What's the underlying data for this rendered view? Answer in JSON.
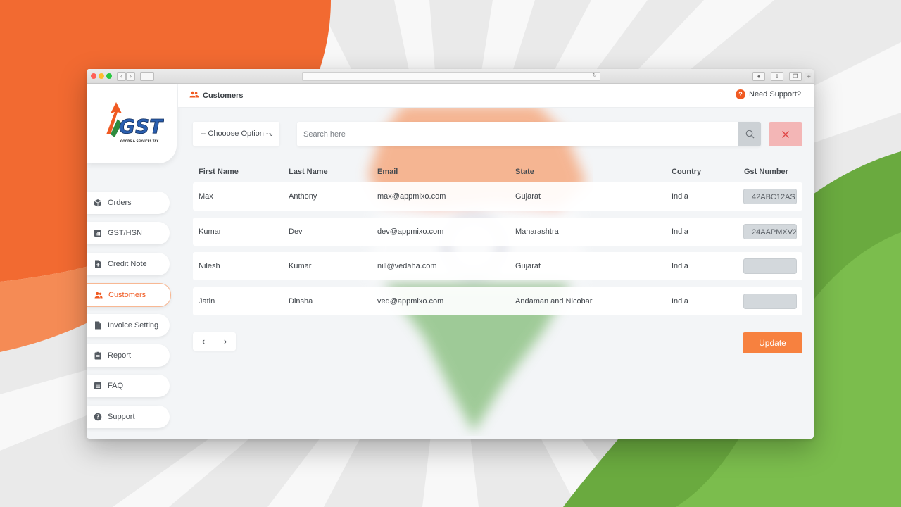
{
  "header": {
    "title": "Customers",
    "support_label": "Need Support?"
  },
  "logo": {
    "text": "GST",
    "tagline": "GOODS & SERVICES TAX"
  },
  "sidebar": {
    "items": [
      {
        "label": "Orders",
        "icon": "box-icon"
      },
      {
        "label": "GST/HSN",
        "icon": "bar-chart-icon"
      },
      {
        "label": "Credit Note",
        "icon": "file-plus-icon"
      },
      {
        "label": "Customers",
        "icon": "users-icon",
        "active": true
      },
      {
        "label": "Invoice Setting",
        "icon": "file-icon"
      },
      {
        "label": "Report",
        "icon": "clipboard-icon"
      },
      {
        "label": "FAQ",
        "icon": "list-icon"
      },
      {
        "label": "Support",
        "icon": "question-circle-icon"
      }
    ]
  },
  "filters": {
    "select_label": "-- Chooose Option --",
    "search_placeholder": "Search here"
  },
  "table": {
    "columns": [
      "First Name",
      "Last Name",
      "Email",
      "State",
      "Country",
      "Gst Number"
    ],
    "rows": [
      {
        "first": "Max",
        "last": "Anthony",
        "email": "max@appmixo.com",
        "state": "Gujarat",
        "country": "India",
        "gst": "42ABC12AS"
      },
      {
        "first": "Kumar",
        "last": "Dev",
        "email": "dev@appmixo.com",
        "state": "Maharashtra",
        "country": "India",
        "gst": "24AAPMXV2"
      },
      {
        "first": "Nilesh",
        "last": "Kumar",
        "email": "nill@vedaha.com",
        "state": "Gujarat",
        "country": "India",
        "gst": ""
      },
      {
        "first": "Jatin",
        "last": "Dinsha",
        "email": "ved@appmixo.com",
        "state": "Andaman and Nicobar",
        "country": "India",
        "gst": ""
      }
    ]
  },
  "pager": {
    "prev": "‹",
    "next": "›"
  },
  "actions": {
    "update_label": "Update"
  },
  "colors": {
    "accent": "#f05a22",
    "saffron": "#f7813f",
    "green": "#6aaa3f",
    "clear_button": "#f3b6b6"
  }
}
